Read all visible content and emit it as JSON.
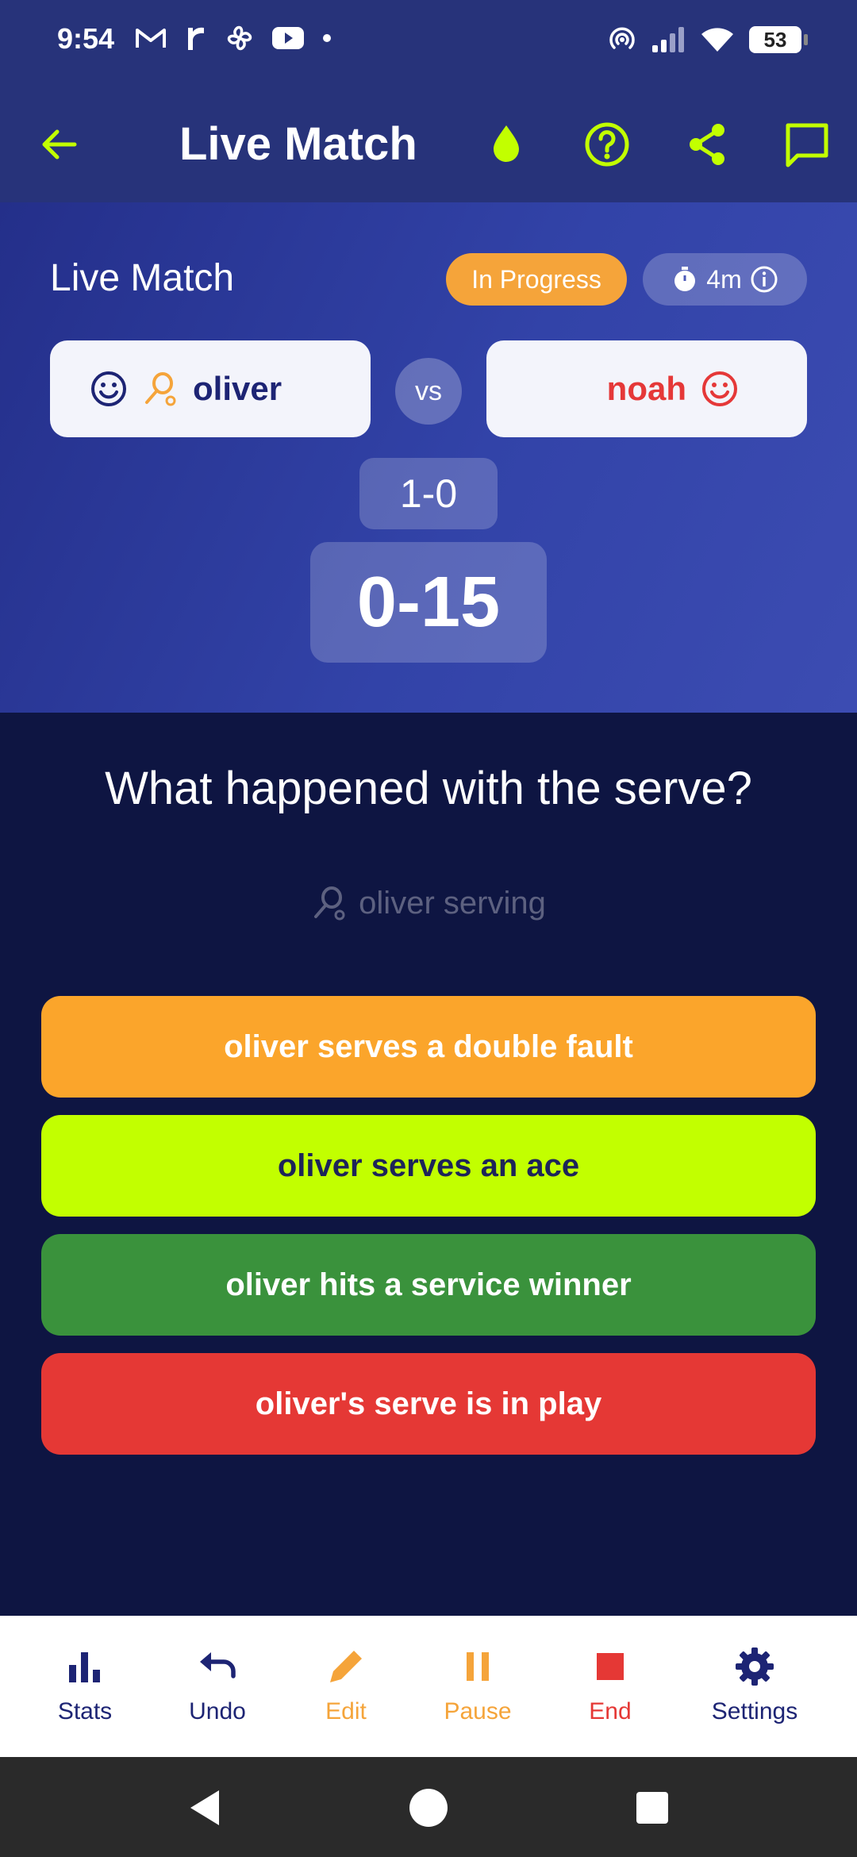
{
  "status_bar": {
    "time": "9:54",
    "battery": "53",
    "left_icons": [
      "gmail-icon",
      "r-app-icon",
      "pinwheel-icon",
      "youtube-icon",
      "dot-icon"
    ],
    "right_icons": [
      "hotspot-icon",
      "signal-icon",
      "wifi-icon",
      "battery-icon"
    ]
  },
  "app_bar": {
    "title": "Live Match",
    "icons": [
      "back-arrow-icon",
      "drop-icon",
      "help-icon",
      "share-icon",
      "chat-icon"
    ],
    "accent_color": "#c2ff00"
  },
  "match": {
    "label": "Live Match",
    "status": "In Progress",
    "timer": "4m",
    "player_left": "oliver",
    "player_right": "noah",
    "vs": "vs",
    "sets_score": "1-0",
    "game_score": "0-15"
  },
  "question": {
    "text": "What happened with the serve?",
    "serving_text": "oliver serving"
  },
  "options": [
    {
      "label": "oliver serves a double fault",
      "color": "#fba52b"
    },
    {
      "label": "oliver serves an ace",
      "color": "#c2ff00"
    },
    {
      "label": "oliver hits a service winner",
      "color": "#3a923c"
    },
    {
      "label": "oliver's serve is in play",
      "color": "#e53835"
    }
  ],
  "bottom_nav": {
    "stats": "Stats",
    "undo": "Undo",
    "edit": "Edit",
    "pause": "Pause",
    "end": "End",
    "settings": "Settings"
  }
}
